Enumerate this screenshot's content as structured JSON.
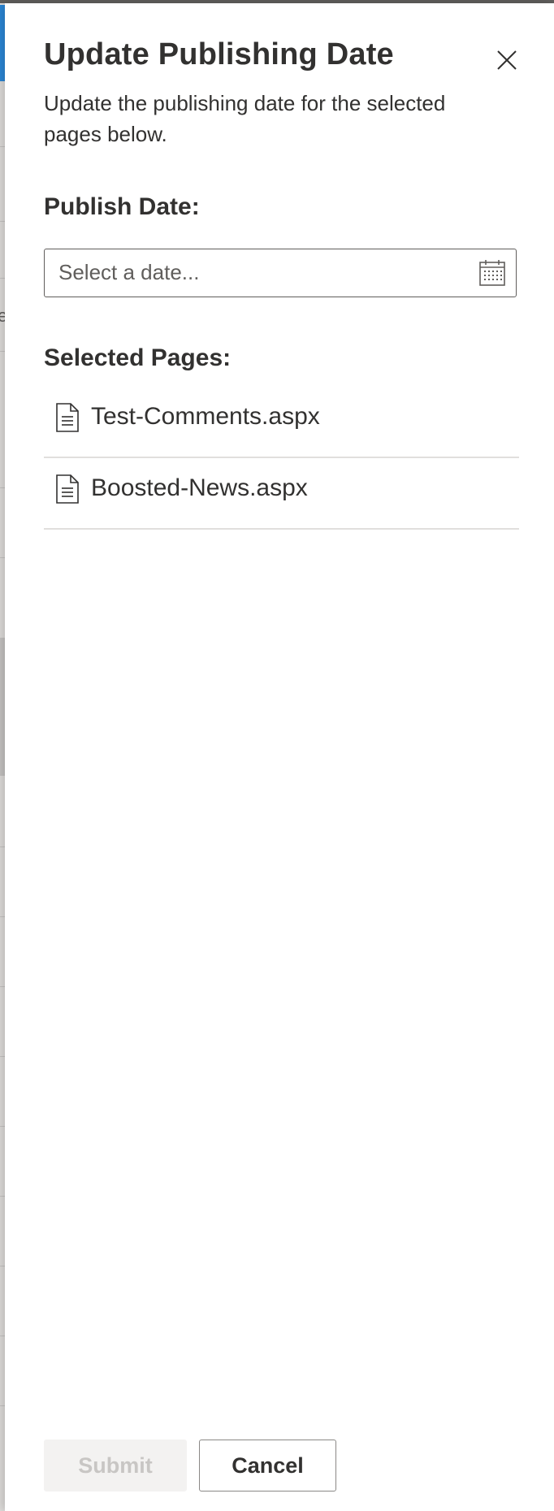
{
  "panel": {
    "title": "Update Publishing Date",
    "description": "Update the publishing date for the selected pages below.",
    "close_icon": "close-icon"
  },
  "publish_date": {
    "label": "Publish Date:",
    "placeholder": "Select a date...",
    "value": "",
    "icon": "calendar-icon"
  },
  "selected_pages": {
    "label": "Selected Pages:",
    "items": [
      {
        "name": "Test-Comments.aspx",
        "icon": "document-icon"
      },
      {
        "name": "Boosted-News.aspx",
        "icon": "document-icon"
      }
    ]
  },
  "footer": {
    "submit_label": "Submit",
    "submit_disabled": true,
    "cancel_label": "Cancel"
  },
  "background": {
    "partial_text": "e"
  }
}
